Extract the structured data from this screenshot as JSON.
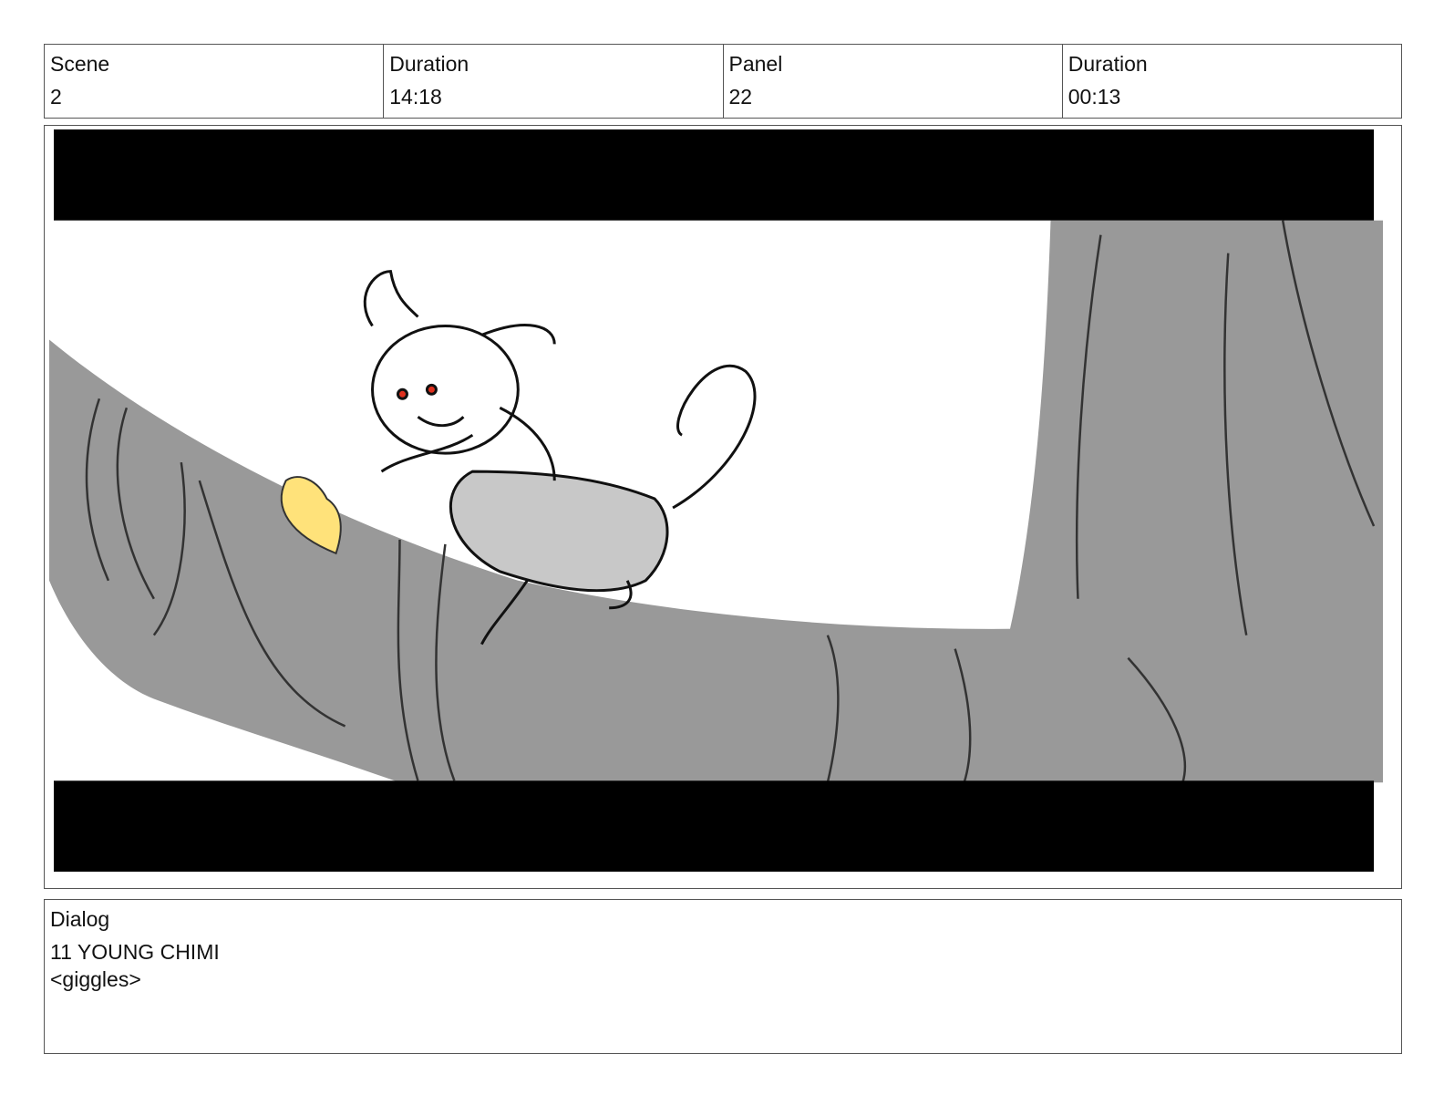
{
  "header": {
    "scene_label": "Scene",
    "scene_value": "2",
    "scene_duration_label": "Duration",
    "scene_duration_value": "14:18",
    "panel_label": "Panel",
    "panel_value": "22",
    "panel_duration_label": "Duration",
    "panel_duration_value": "00:13"
  },
  "dialog": {
    "label": "Dialog",
    "speaker": "11 YOUNG CHIMI",
    "line": "<giggles>"
  },
  "colors": {
    "letterbox": "#000000",
    "tree": "#999999",
    "monkey": "#c8c8c8",
    "banana": "#ffe27a",
    "eyes": "#e0301e"
  }
}
